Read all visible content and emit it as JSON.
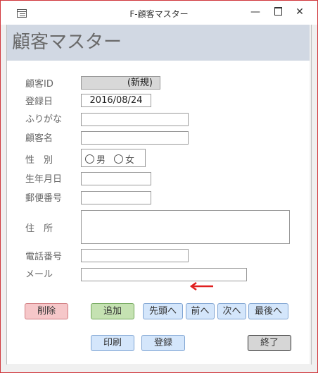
{
  "window": {
    "title": "F-顧客マスター",
    "minimize_icon": "minimize-icon",
    "maximize_icon": "maximize-icon",
    "close_icon": "close-icon"
  },
  "form": {
    "title": "顧客マスター"
  },
  "fields": {
    "customer_id": {
      "label": "顧客ID",
      "value": "(新規)"
    },
    "reg_date": {
      "label": "登録日",
      "value": "2016/08/24"
    },
    "furigana": {
      "label": "ふりがな",
      "value": ""
    },
    "name": {
      "label": "顧客名",
      "value": ""
    },
    "gender": {
      "label": "性　別",
      "options": [
        "男",
        "女"
      ]
    },
    "birthdate": {
      "label": "生年月日",
      "value": ""
    },
    "postal": {
      "label": "郵便番号",
      "value": ""
    },
    "address": {
      "label": "住　所",
      "value": ""
    },
    "phone": {
      "label": "電話番号",
      "value": ""
    },
    "email": {
      "label": "メール",
      "value": ""
    }
  },
  "buttons": {
    "delete": "削除",
    "add": "追加",
    "first": "先頭へ",
    "prev": "前へ",
    "next": "次へ",
    "last": "最後へ",
    "print": "印刷",
    "register": "登録",
    "close": "終了"
  },
  "colors": {
    "arrow": "#e02020",
    "header_band": "#d1d8e3"
  }
}
